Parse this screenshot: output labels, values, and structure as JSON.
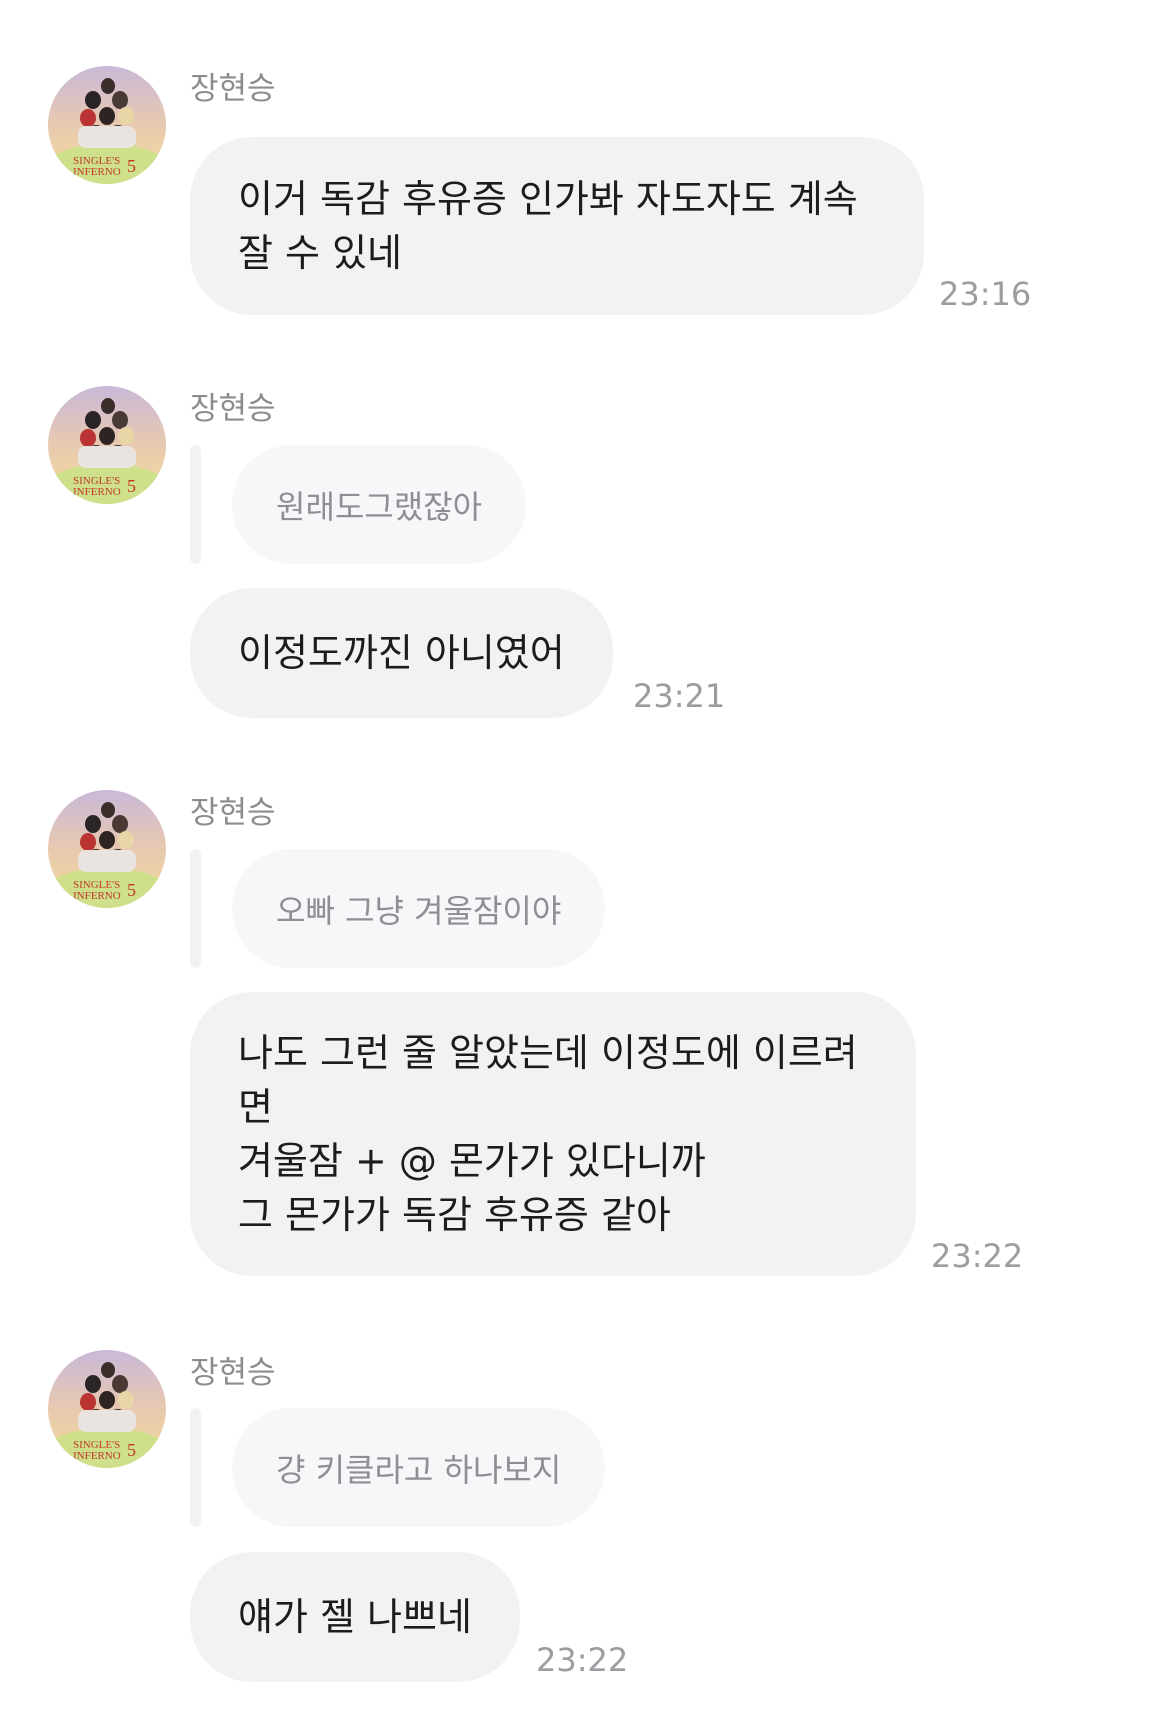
{
  "messages": [
    {
      "sender": "장현승",
      "quote": null,
      "text": "이거 독감 후유증 인가봐 자도자도 계속\n잘 수 있네",
      "time": "23:16"
    },
    {
      "sender": "장현승",
      "quote": "원래도그랬잖아",
      "text": "이정도까진 아니였어",
      "time": "23:21"
    },
    {
      "sender": "장현승",
      "quote": "오빠 그냥 겨울잠이야",
      "text": "나도 그런 줄 알았는데 이정도에 이르려\n면\n겨울잠 + @ 몬가가 있다니까\n그 몬가가 독감 후유증 같아",
      "time": "23:22"
    },
    {
      "sender": "장현승",
      "quote": "걍 키클라고 하나보지",
      "text": "얘가 젤 나쁘네",
      "time": "23:22"
    }
  ],
  "avatar": {
    "icon": "profile-avatar-icon",
    "poster_caption_line1": "SINGLE'S",
    "poster_caption_line2": "INFERNO",
    "poster_number": "5"
  },
  "colors": {
    "bubble": "#f2f2f4",
    "quote_bubble": "#f7f7fa",
    "text": "#1c1c1e",
    "meta": "#8b8b90"
  }
}
